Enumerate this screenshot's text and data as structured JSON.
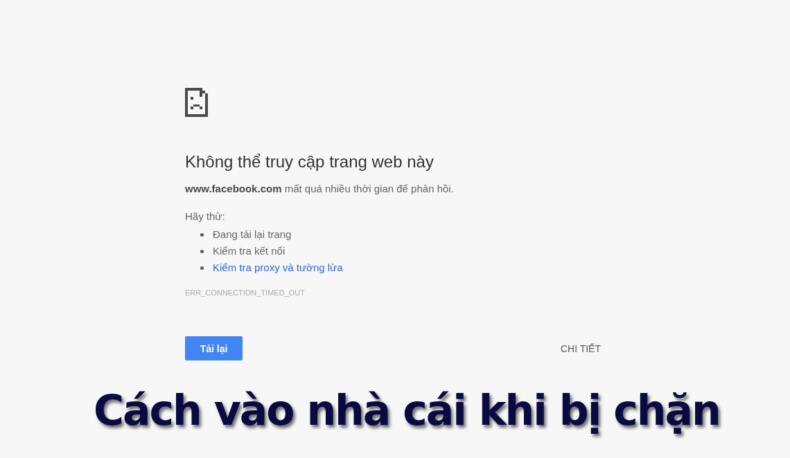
{
  "error_page": {
    "heading": "Không thể truy cập trang web này",
    "message": "**www.facebook.com** mất quá nhiều thời gian để phản hồi.",
    "suggestions_label": "Hãy thử:",
    "suggestions": [
      {
        "text": "Đang tải lại trang",
        "kind": "text"
      },
      {
        "text": "Kiểm tra kết nối",
        "kind": "text"
      },
      {
        "text": "Kiểm tra proxy và tường lửa",
        "kind": "link"
      }
    ],
    "error_code": "ERR_CONNECTION_TIMED_OUT",
    "buttons": {
      "reload": "Tải lại",
      "details": "CHI TIẾT"
    }
  },
  "caption": "Cách vào nhà cái khi bị chặn"
}
